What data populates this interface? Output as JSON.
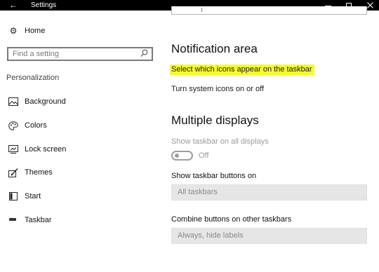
{
  "window": {
    "title": "Settings",
    "back_icon": "back-arrow-icon",
    "minimize_icon": "minimize-icon",
    "maximize_icon": "maximize-icon",
    "close_icon": "close-icon",
    "titlebar_color": "#000000"
  },
  "sidebar": {
    "home": {
      "label": "Home",
      "icon": "gear-icon"
    },
    "search": {
      "placeholder": "Find a setting",
      "icon": "search-icon"
    },
    "section_title": "Personalization",
    "items": [
      {
        "label": "Background",
        "icon": "picture-icon"
      },
      {
        "label": "Colors",
        "icon": "palette-icon"
      },
      {
        "label": "Lock screen",
        "icon": "lock-screen-icon"
      },
      {
        "label": "Themes",
        "icon": "brush-icon"
      },
      {
        "label": "Start",
        "icon": "start-icon"
      },
      {
        "label": "Taskbar",
        "icon": "taskbar-icon",
        "selected": true
      }
    ]
  },
  "main": {
    "notification_area": {
      "heading": "Notification area",
      "link_icons": "Select which icons appear on the taskbar",
      "link_system": "Turn system icons on or off",
      "highlight_color": "#f4fb2f"
    },
    "multiple_displays": {
      "heading": "Multiple displays",
      "show_all_label": "Show taskbar on all displays",
      "show_all_state": "Off",
      "show_all_enabled": false,
      "buttons_label": "Show taskbar buttons on",
      "buttons_value": "All taskbars",
      "combine_label": "Combine buttons on other taskbars",
      "combine_value": "Always, hide labels"
    }
  }
}
